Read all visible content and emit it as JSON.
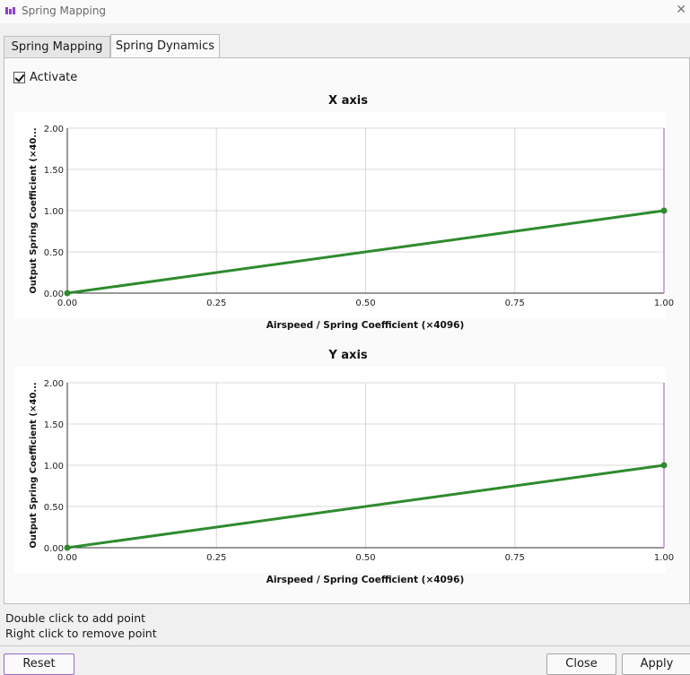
{
  "window": {
    "title": "Spring Mapping"
  },
  "tabs": [
    {
      "label": "Spring Mapping"
    },
    {
      "label": "Spring Dynamics"
    }
  ],
  "activate": {
    "label": "Activate",
    "checked": true
  },
  "colors": {
    "line": "#2e8b2e",
    "handle": "#c38ad6",
    "grid": "#d8d8d8"
  },
  "charts": [
    {
      "title": "X axis",
      "xlabel": "Airspeed / Spring Coefficient (×4096)",
      "ylabel": "Output Spring Coefficient (×40...",
      "xticks": [
        "0.00",
        "0.25",
        "0.50",
        "0.75",
        "1.00"
      ],
      "yticks": [
        "0.00",
        "0.50",
        "1.00",
        "1.50",
        "2.00"
      ]
    },
    {
      "title": "Y axis",
      "xlabel": "Airspeed / Spring Coefficient (×4096)",
      "ylabel": "Output Spring Coefficient (×40...",
      "xticks": [
        "0.00",
        "0.25",
        "0.50",
        "0.75",
        "1.00"
      ],
      "yticks": [
        "0.00",
        "0.50",
        "1.00",
        "1.50",
        "2.00"
      ]
    }
  ],
  "chart_data": [
    {
      "type": "line",
      "title": "X axis",
      "xlabel": "Airspeed / Spring Coefficient (×4096)",
      "ylabel": "Output Spring Coefficient (×40...",
      "xlim": [
        0,
        1
      ],
      "ylim": [
        0,
        2
      ],
      "grid": true,
      "series": [
        {
          "x": [
            0,
            1
          ],
          "y": [
            0,
            1
          ]
        }
      ]
    },
    {
      "type": "line",
      "title": "Y axis",
      "xlabel": "Airspeed / Spring Coefficient (×4096)",
      "ylabel": "Output Spring Coefficient (×40...",
      "xlim": [
        0,
        1
      ],
      "ylim": [
        0,
        2
      ],
      "grid": true,
      "series": [
        {
          "x": [
            0,
            1
          ],
          "y": [
            0,
            1
          ]
        }
      ]
    }
  ],
  "hints": [
    "Double click to add point",
    "Right click to remove point"
  ],
  "buttons": {
    "reset": "Reset",
    "close": "Close",
    "apply": "Apply"
  }
}
